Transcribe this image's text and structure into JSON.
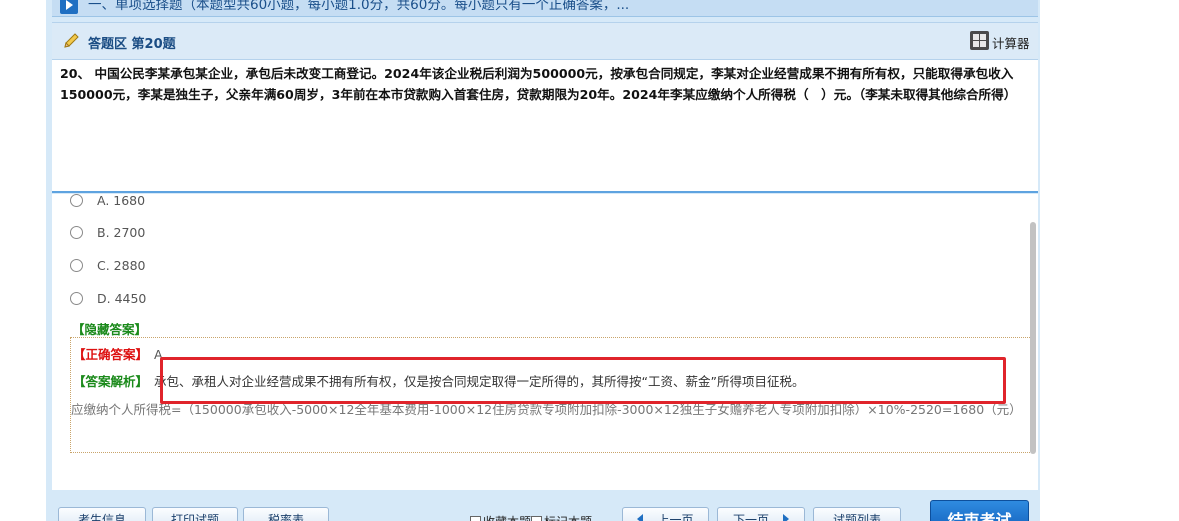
{
  "section": {
    "title": "一、单项选择题（本题型共60小题，每小题1.0分，共60分。每小题只有一个正确答案，..."
  },
  "answer_area": {
    "title": "答题区 第20题",
    "calculator_label": "计算器"
  },
  "question": {
    "text": "20、 中国公民李某承包某企业，承包后未改变工商登记。2024年该企业税后利润为500000元，按承包合同规定，李某对企业经营成果不拥有所有权，只能取得承包收入150000元，李某是独生子，父亲年满60周岁，3年前在本市贷款购入首套住房，贷款期限为20年。2024年李某应缴纳个人所得税（　）元。（李某未取得其他综合所得）"
  },
  "options": [
    {
      "label": "A. 1680"
    },
    {
      "label": "B. 2700"
    },
    {
      "label": "C. 2880"
    },
    {
      "label": "D. 4450"
    }
  ],
  "answer": {
    "hide_label": "【隐藏答案】",
    "correct_label": "【正确答案】",
    "correct_value": "A",
    "analysis_label": "【答案解析】",
    "analysis_text": "承包、承租人对企业经营成果不拥有所有权，仅是按合同规定取得一定所得的，其所得按“工资、薪金”所得项目征税。",
    "formula": "应缴纳个人所得税=（150000承包收入-5000×12全年基本费用-1000×12住房贷款专项附加扣除-3000×12独生子女赡养老人专项附加扣除）×10%-2520=1680（元）"
  },
  "toolbar": {
    "candidate_info": "考生信息",
    "print_question": "打印试题",
    "tax_table": "税率表",
    "favorite": "收藏本题",
    "mark": "标记本题",
    "prev": "上一页",
    "next": "下一页",
    "question_list": "试题列表",
    "end_exam": "结束考试"
  },
  "colors": {
    "accent_blue": "#1f6fc2",
    "panel_blue": "#d6e9f8",
    "correct_red": "#d11111",
    "analysis_green": "#1b8a1b",
    "highlight_red": "#e0242b"
  }
}
